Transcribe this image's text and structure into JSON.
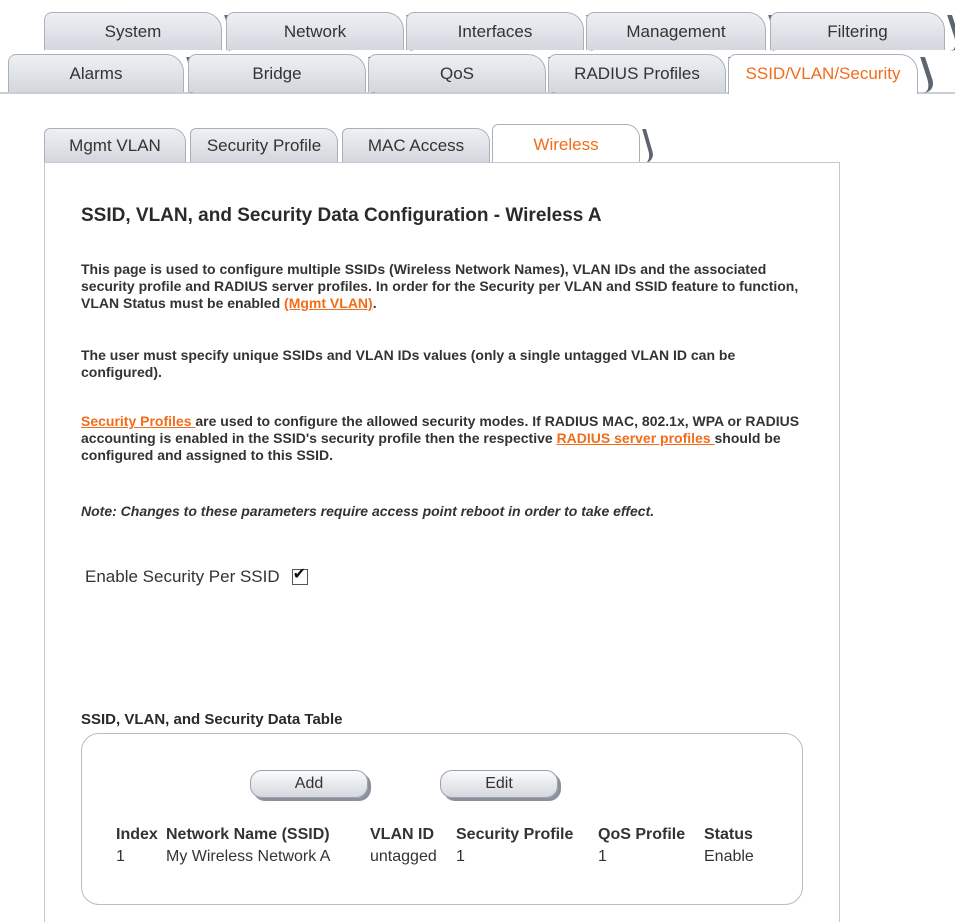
{
  "tabs_row1": [
    "System",
    "Network",
    "Interfaces",
    "Management",
    "Filtering"
  ],
  "tabs_row2": [
    "Alarms",
    "Bridge",
    "QoS",
    "RADIUS Profiles",
    "SSID/VLAN/Security"
  ],
  "tabs_row2_active": "SSID/VLAN/Security",
  "subtabs": [
    "Mgmt VLAN",
    "Security Profile",
    "MAC Access",
    "Wireless"
  ],
  "subtabs_active": "Wireless",
  "page": {
    "title": "SSID, VLAN, and Security Data Configuration - Wireless A",
    "p1_text": "This page is used to configure multiple SSIDs (Wireless Network Names), VLAN IDs and the associated security profile and RADIUS server profiles. In order for the Security per VLAN and SSID feature to function, VLAN Status must be enabled ",
    "p1_link": "(Mgmt VLAN)",
    "p1_end": ".",
    "p2_text": "The user must specify unique SSIDs and VLAN IDs values (only a single untagged VLAN ID can be configured).",
    "p3_link1": "Security Profiles ",
    "p3_text1": "are used to configure the allowed security modes. If RADIUS MAC, 802.1x, WPA or RADIUS accounting is enabled in the SSID's security profile then the respective ",
    "p3_link2": "RADIUS server profiles ",
    "p3_text2": "should be configured and assigned to this SSID.",
    "note": "Note: Changes to these parameters require access point reboot in order to take effect.",
    "enable_label": "Enable Security Per SSID",
    "enable_checked": true,
    "checkmark": "✔"
  },
  "table": {
    "title": "SSID, VLAN, and Security Data Table",
    "add_label": "Add",
    "edit_label": "Edit",
    "headers": [
      "Index",
      "Network Name (SSID)",
      "VLAN ID",
      "Security Profile",
      "QoS Profile",
      "Status"
    ],
    "rows": [
      [
        "1",
        "My Wireless Network A",
        "untagged",
        "1",
        "1",
        "Enable"
      ]
    ]
  },
  "colors": {
    "accent": "#f26c1a",
    "tab_bg": "#d3d7de",
    "border": "#c3c8cf"
  }
}
